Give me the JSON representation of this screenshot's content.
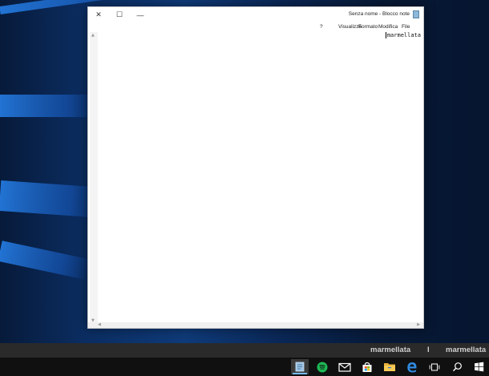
{
  "window": {
    "title": "Senza nome - Blocco note",
    "controls": {
      "close": "✕",
      "maximize": "☐",
      "minimize": "—"
    }
  },
  "menu": {
    "file": "File",
    "edit": "Modifica",
    "format": "Formato",
    "view": "Visualizza",
    "help": "?"
  },
  "editor": {
    "text": "marmellata"
  },
  "reflection": {
    "a": "marmellata",
    "b": "I",
    "c": "marmellata"
  },
  "taskbar": {
    "icons": [
      "notepad-icon",
      "spotify-icon",
      "mail-icon",
      "store-icon",
      "file-explorer-icon",
      "edge-icon",
      "task-view-icon",
      "search-icon",
      "start-icon"
    ]
  },
  "colors": {
    "wallpaper_accent": "#2378dc",
    "taskbar": "#101010",
    "active_indicator": "#76b9ed"
  }
}
